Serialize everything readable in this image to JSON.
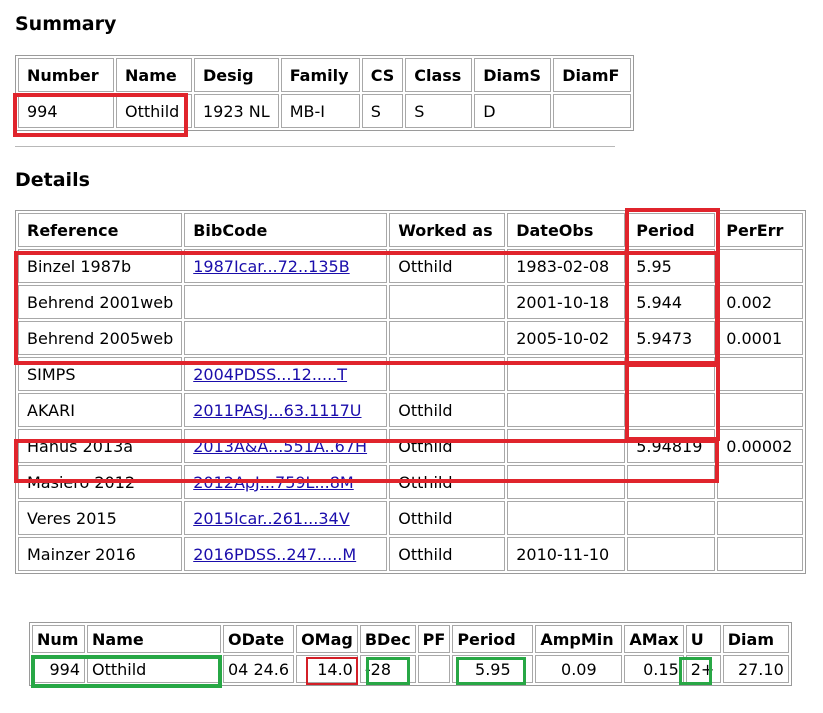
{
  "summary": {
    "heading": "Summary",
    "headers": [
      "Number",
      "Name",
      "Desig",
      "Family",
      "CS",
      "Class",
      "DiamS",
      "DiamF"
    ],
    "row": [
      "994",
      "Otthild",
      "1923 NL",
      "MB-I",
      "S",
      "S",
      "D",
      ""
    ]
  },
  "details": {
    "heading": "Details",
    "headers": [
      "Reference",
      "BibCode",
      "Worked as",
      "DateObs",
      "Period",
      "PerErr"
    ],
    "rows": [
      [
        "Binzel 1987b",
        "1987Icar...72..135B",
        "Otthild",
        "1983-02-08",
        "5.95",
        ""
      ],
      [
        "Behrend 2001web",
        "",
        "",
        "2001-10-18",
        "5.944",
        "0.002"
      ],
      [
        "Behrend 2005web",
        "",
        "",
        "2005-10-02",
        "5.9473",
        "0.0001"
      ],
      [
        "SIMPS",
        "2004PDSS...12.....T",
        "",
        "",
        "",
        ""
      ],
      [
        "AKARI",
        "2011PASJ...63.1117U",
        "Otthild",
        "",
        "",
        ""
      ],
      [
        "Hanus 2013a",
        "2013A&A...551A..67H",
        "Otthild",
        "",
        "5.94819",
        "0.00002"
      ],
      [
        "Masiero 2012",
        "2012ApJ...759L...8M",
        "Otthild",
        "",
        "",
        ""
      ],
      [
        "Veres 2015",
        "2015Icar..261...34V",
        "Otthild",
        "",
        "",
        ""
      ],
      [
        "Mainzer 2016",
        "2016PDSS..247.....M",
        "Otthild",
        "2010-11-10",
        "",
        ""
      ]
    ]
  },
  "observation": {
    "headers": [
      "Num",
      "Name",
      "ODate",
      "OMag",
      "BDec",
      "PF",
      "Period",
      "AmpMin",
      "AMax",
      "U",
      "Diam"
    ],
    "row": [
      "994",
      "Otthild",
      "04 24.6",
      "14.0",
      "-28",
      "",
      "5.95",
      "0.09",
      "0.15",
      "2+",
      "27.10"
    ]
  },
  "colors": {
    "highlight_red": "#e0242c",
    "highlight_green": "#27a745",
    "link": "#1a0dab"
  }
}
